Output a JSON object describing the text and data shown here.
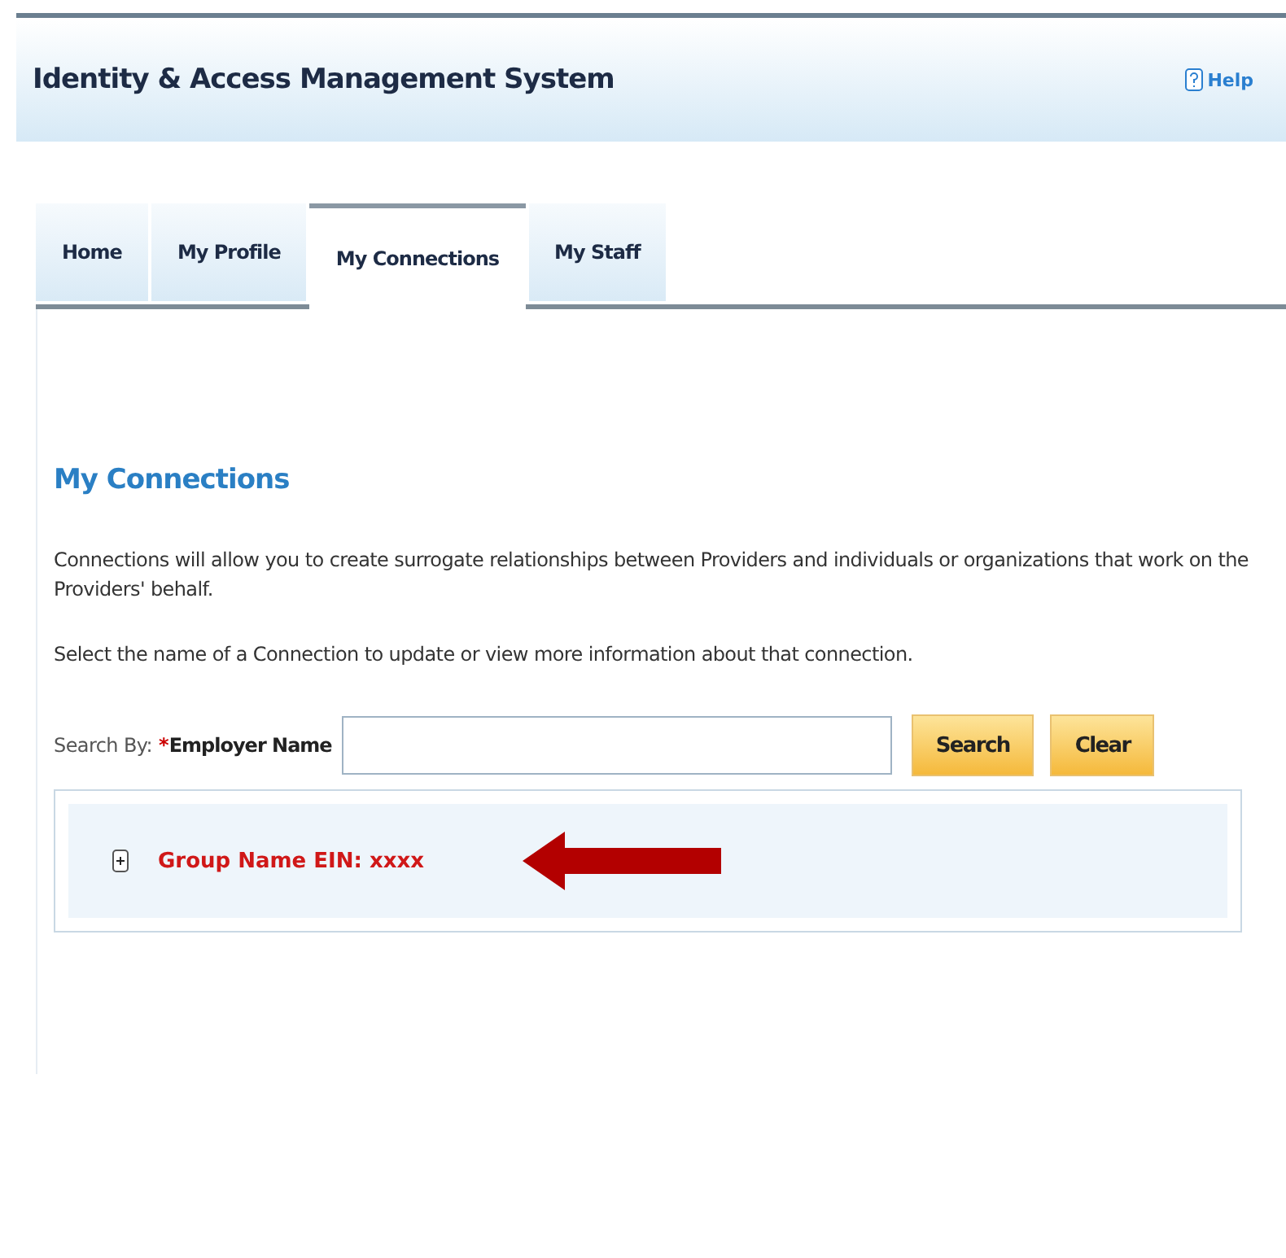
{
  "header": {
    "title": "Identity & Access Management System",
    "help": "Help"
  },
  "tabs": [
    {
      "label": "Home",
      "selected": false
    },
    {
      "label": "My Profile",
      "selected": false
    },
    {
      "label": "My Connections",
      "selected": true
    },
    {
      "label": "My Staff",
      "selected": false
    }
  ],
  "page_title": "My Connections",
  "intro": "Connections will allow you to create surrogate relationships between Providers and individuals or organizations that work on the Providers' behalf.",
  "instruction": "Select the name of a Connection to update or view more information about that connection.",
  "search": {
    "label": "Search By:",
    "required_mark": "*",
    "field_label": "Employer Name",
    "buttons": [
      "Search",
      "Clear"
    ]
  },
  "results": [
    {
      "name": "Group Name EIN: xxxx",
      "expanded": false
    }
  ]
}
